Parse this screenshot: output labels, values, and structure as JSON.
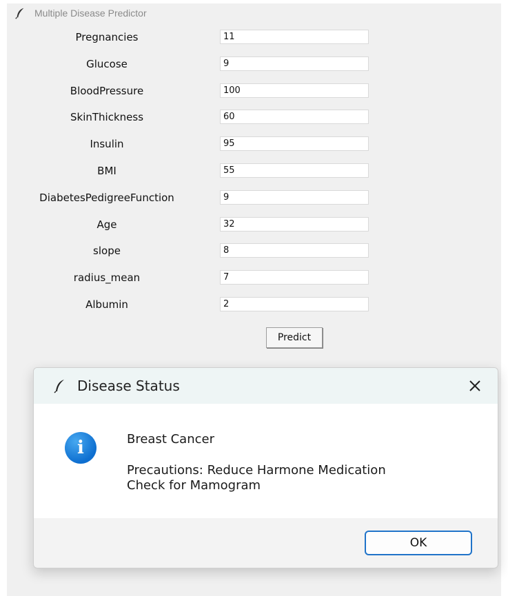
{
  "app": {
    "title": "Multiple Disease Predictor"
  },
  "form": {
    "fields": [
      {
        "label": "Pregnancies",
        "value": "11"
      },
      {
        "label": "Glucose",
        "value": "9"
      },
      {
        "label": "BloodPressure",
        "value": "100"
      },
      {
        "label": "SkinThickness",
        "value": "60"
      },
      {
        "label": "Insulin",
        "value": "95"
      },
      {
        "label": "BMI",
        "value": "55"
      },
      {
        "label": "DiabetesPedigreeFunction",
        "value": "9"
      },
      {
        "label": "Age",
        "value": "32"
      },
      {
        "label": "slope",
        "value": "8"
      },
      {
        "label": "radius_mean",
        "value": "7"
      },
      {
        "label": "Albumin",
        "value": "2"
      }
    ],
    "predict_label": "Predict"
  },
  "dialog": {
    "title": "Disease Status",
    "close_glyph": "✕",
    "info_glyph": "i",
    "line1": "Breast Cancer",
    "line2": "Precautions: Reduce Harmone Medication",
    "line3": "Check for Mamogram",
    "ok_label": "OK",
    "accent_color": "#1f73c9"
  }
}
